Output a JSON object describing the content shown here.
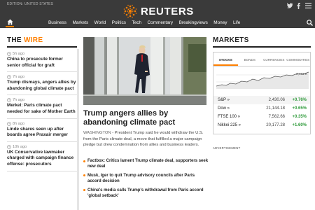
{
  "header": {
    "edition": "EDITION: UNITED STATES",
    "brand": "REUTERS",
    "nav": [
      "Business",
      "Markets",
      "World",
      "Politics",
      "Tech",
      "Commentary",
      "Breakingviews",
      "Money",
      "Life"
    ]
  },
  "wire": {
    "title_prefix": "THE ",
    "title_accent": "WIRE",
    "items": [
      {
        "time": "5h ago",
        "title": "China to prosecute former senior official for graft"
      },
      {
        "time": "7h ago",
        "title": "Trump dismays, angers allies by abandoning global climate pact"
      },
      {
        "time": "7h ago",
        "title": "Merkel: Paris climate pact needed for sake of Mother Earth"
      },
      {
        "time": "8h ago",
        "title": "Linde shares seen up after boards agree Praxair merger"
      },
      {
        "time": "10h ago",
        "title": "UK Conservative lawmaker charged with campaign finance offense: prosecutors"
      }
    ]
  },
  "story": {
    "headline": "Trump angers allies by abandoning climate pact",
    "dateline": "WASHINGTON",
    "summary": " - President Trump said he would withdraw the U.S. from the Paris climate deal, a move that fulfilled a major campaign pledge but drew condemnation from allies and business leaders.",
    "bullets": [
      "Factbox: Critics lament Trump climate deal, supporters seek new deal",
      "Musk, Iger to quit Trump advisory councils after Paris accord decision",
      "China's media calls Trump's withdrawal from Paris accord 'global setback'"
    ]
  },
  "markets": {
    "title": "MARKETS",
    "tabs": [
      "STOCKS",
      "BONDS",
      "CURRENCIES",
      "COMMODITIES"
    ],
    "active_tab": "STOCKS",
    "chart_label": "2,433 K",
    "rows": [
      {
        "name": "S&P »",
        "value": "2,430.06",
        "change": "+0.76%"
      },
      {
        "name": "Dow »",
        "value": "21,144.18",
        "change": "+0.65%"
      },
      {
        "name": "FTSE 100 »",
        "value": "7,562.66",
        "change": "+0.35%"
      },
      {
        "name": "Nikkei 225 »",
        "value": "20,177.28",
        "change": "+1.60%"
      }
    ],
    "advertisement_label": "ADVERTISEMENT"
  },
  "colors": {
    "topbar": "#3a3a3a",
    "accent": "#ff8000",
    "positive": "#2e9a3a"
  }
}
